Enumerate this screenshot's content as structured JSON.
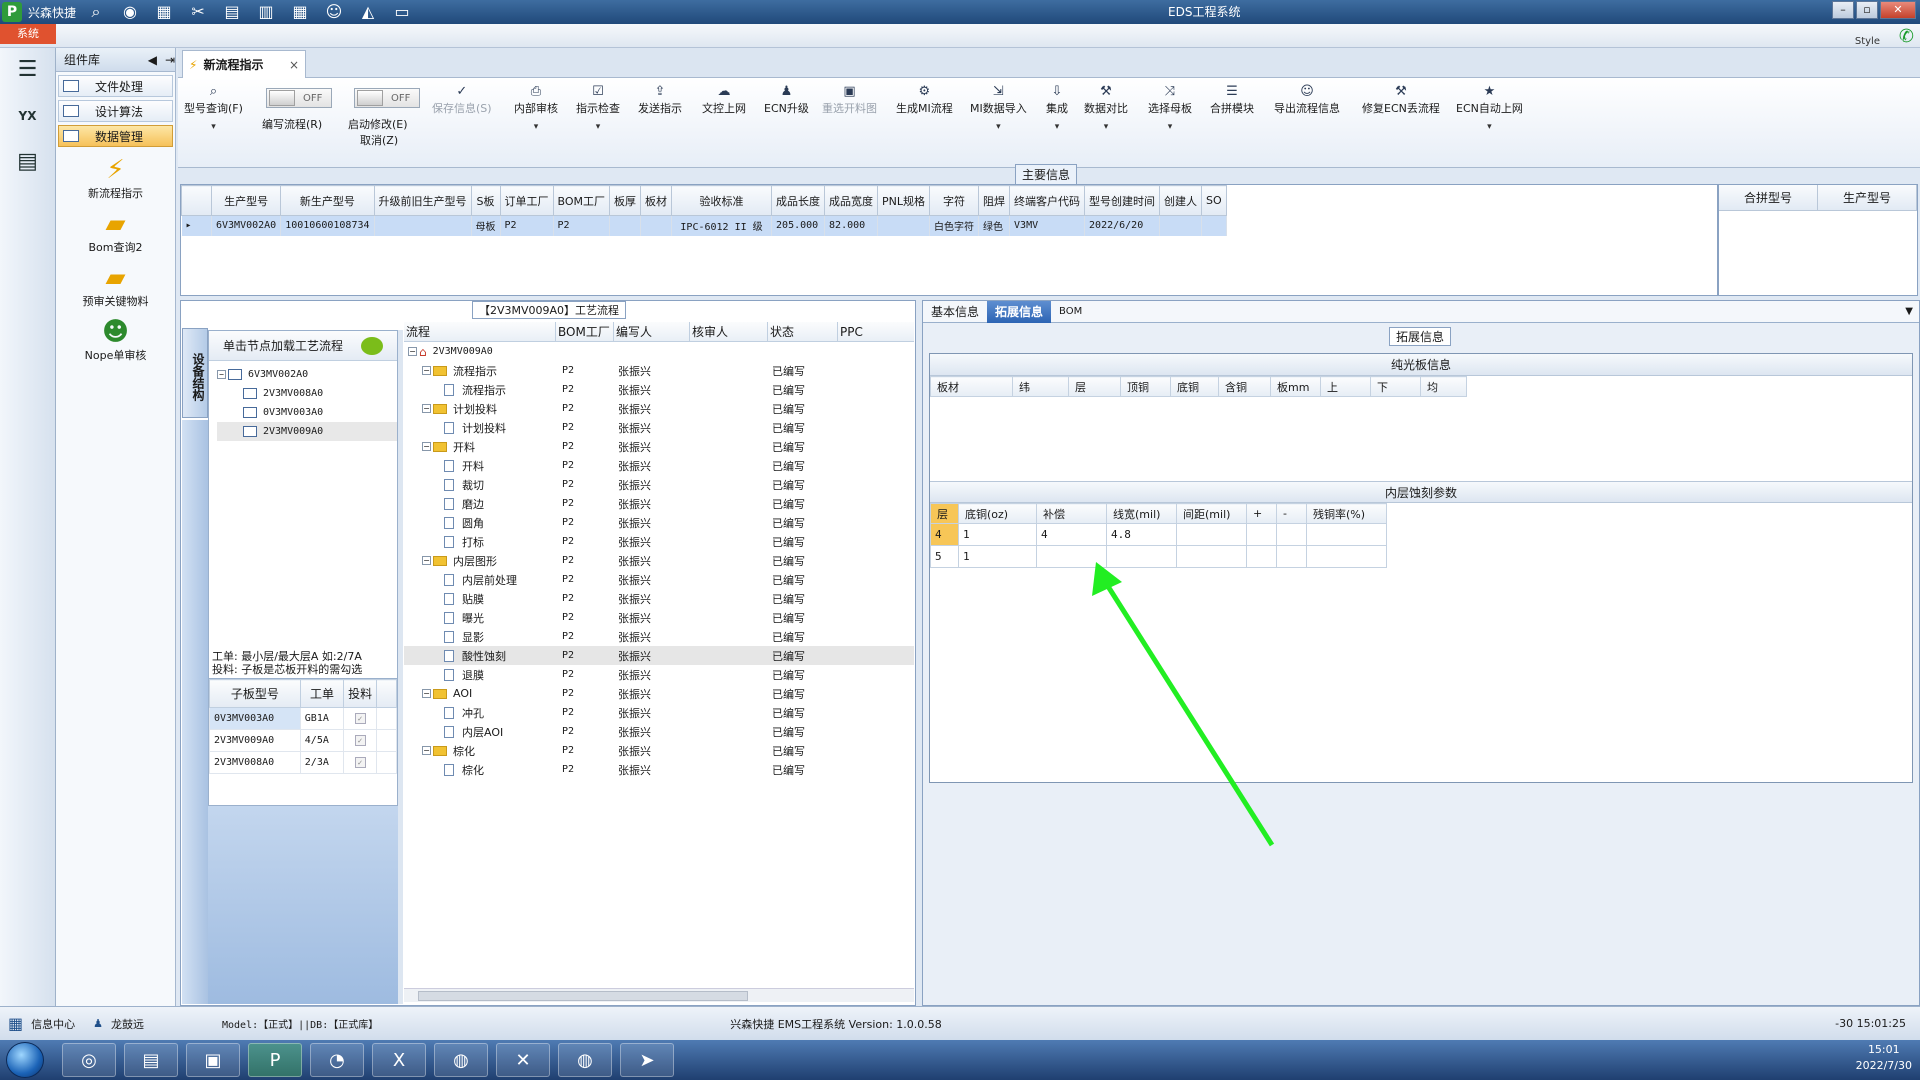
{
  "app": {
    "name": "兴森快捷",
    "window_title": "EDS工程系统",
    "style_label": "Style",
    "sys_tab": "系统"
  },
  "menu": {
    "title": "组件库",
    "items": [
      {
        "label": "文件处理"
      },
      {
        "label": "设计算法"
      },
      {
        "label": "数据管理"
      }
    ],
    "launchers": [
      {
        "label": "新流程指示"
      },
      {
        "label": "Bom查询2"
      },
      {
        "label": "预审关键物料"
      },
      {
        "label": "Nope单审核"
      }
    ]
  },
  "doc_tab": {
    "label": "新流程指示"
  },
  "ribbon": {
    "query": "型号查询(F)",
    "edit_flow": "编写流程(R)",
    "toggle_off": "OFF",
    "start_modify": "启动修改(E)",
    "cancel": "取消(Z)",
    "save": "保存信息(S)",
    "internal_review": "内部审核",
    "check": "指示检查",
    "send": "发送指示",
    "upload": "文控上网",
    "ecn_up": "ECN升级",
    "regen": "重选开料图",
    "gen_mi": "生成MI流程",
    "mi_import": "MI数据导入",
    "integrate": "集成",
    "compare": "数据对比",
    "choose_mother": "选择母板",
    "merge": "合拼模块",
    "export": "导出流程信息",
    "fix_ecn": "修复ECN丢流程",
    "ecn_auto": "ECN自动上网"
  },
  "main_info": {
    "caption": "主要信息",
    "columns": [
      "生产型号",
      "新生产型号",
      "升级前旧生产型号",
      "S板",
      "订单工厂",
      "BOM工厂",
      "板厚",
      "板材",
      "验收标准",
      "成品长度",
      "成品宽度",
      "PNL规格",
      "字符",
      "阻焊",
      "终端客户代码",
      "型号创建时间",
      "创建人",
      "SO"
    ],
    "row": [
      "6V3MV002A0",
      "10010600108734",
      "",
      "母板",
      "P2",
      "P2",
      "",
      "",
      "IPC-6012 II 级",
      "205.000",
      "82.000",
      "",
      "白色字符",
      "绿色",
      "V3MV",
      "2022/6/20",
      "",
      ""
    ]
  },
  "side_grid": {
    "columns": [
      "合拼型号",
      "生产型号"
    ]
  },
  "flow": {
    "caption": "【2V3MV009A0】工艺流程",
    "vertical_tab": "设备结构",
    "click_hint": "单击节点加载工艺流程",
    "tree": [
      "6V3MV002A0",
      "2V3MV008A0",
      "0V3MV003A0",
      "2V3MV009A0"
    ],
    "hint_lines": [
      "工单: 最小层/最大层A 如:2/7A",
      "投料: 子板是芯板开料的需勾选"
    ],
    "sub_columns": [
      "子板型号",
      "工单",
      "投料"
    ],
    "sub_rows": [
      [
        "0V3MV003A0",
        "GB1A"
      ],
      [
        "2V3MV009A0",
        "4/5A"
      ],
      [
        "2V3MV008A0",
        "2/3A"
      ]
    ],
    "columns": [
      "流程",
      "BOM工厂",
      "编写人",
      "核审人",
      "状态",
      "PPC"
    ],
    "root": "2V3MV009A0",
    "rows": [
      {
        "name": "流程指示",
        "lvl": 1,
        "folder": true
      },
      {
        "name": "流程指示",
        "lvl": 2
      },
      {
        "name": "计划投料",
        "lvl": 1,
        "folder": true
      },
      {
        "name": "计划投料",
        "lvl": 2
      },
      {
        "name": "开料",
        "lvl": 1,
        "folder": true
      },
      {
        "name": "开料",
        "lvl": 2
      },
      {
        "name": "裁切",
        "lvl": 2
      },
      {
        "name": "磨边",
        "lvl": 2
      },
      {
        "name": "圆角",
        "lvl": 2
      },
      {
        "name": "打标",
        "lvl": 2
      },
      {
        "name": "内层图形",
        "lvl": 1,
        "folder": true
      },
      {
        "name": "内层前处理",
        "lvl": 2
      },
      {
        "name": "贴膜",
        "lvl": 2
      },
      {
        "name": "曝光",
        "lvl": 2
      },
      {
        "name": "显影",
        "lvl": 2
      },
      {
        "name": "酸性蚀刻",
        "lvl": 2,
        "sel": true
      },
      {
        "name": "退膜",
        "lvl": 2
      },
      {
        "name": "AOI",
        "lvl": 1,
        "folder": true
      },
      {
        "name": "冲孔",
        "lvl": 2
      },
      {
        "name": "内层AOI",
        "lvl": 2
      },
      {
        "name": "棕化",
        "lvl": 1,
        "folder": true
      },
      {
        "name": "棕化",
        "lvl": 2
      }
    ],
    "factory": "P2",
    "writer": "张振兴",
    "status": "已编写"
  },
  "right": {
    "tabs": [
      "基本信息",
      "拓展信息",
      "BOM"
    ],
    "caption": "拓展信息",
    "bare": {
      "title": "纯光板信息",
      "columns": [
        "板材",
        "纬",
        "层",
        "顶铜",
        "底铜",
        "含铜",
        "板mm",
        "上",
        "下",
        "均"
      ]
    },
    "inner": {
      "title": "内层蚀刻参数",
      "columns": [
        "层",
        "底铜(oz)",
        "补偿",
        "线宽(mil)",
        "间距(mil)",
        "+",
        "-",
        "残铜率(%)"
      ],
      "rows": [
        [
          "4",
          "1",
          "4",
          "4.8",
          "",
          "",
          "",
          ""
        ],
        [
          "5",
          "1",
          "",
          "",
          "",
          "",
          "",
          ""
        ]
      ]
    }
  },
  "status": {
    "info_center": "信息中心",
    "user": "龙鼓远",
    "model": "Model:【正式】||DB:【正式库】",
    "version": "兴森快捷 EMS工程系统 Version: 1.0.0.58",
    "datetime": "-30 15:01:25"
  },
  "taskbar": {
    "time": "15:01",
    "date": "2022/7/30"
  },
  "colors": {
    "accent": "#2c64b4",
    "arrow": "#22ee22",
    "selected_tab": "#f7c657"
  }
}
